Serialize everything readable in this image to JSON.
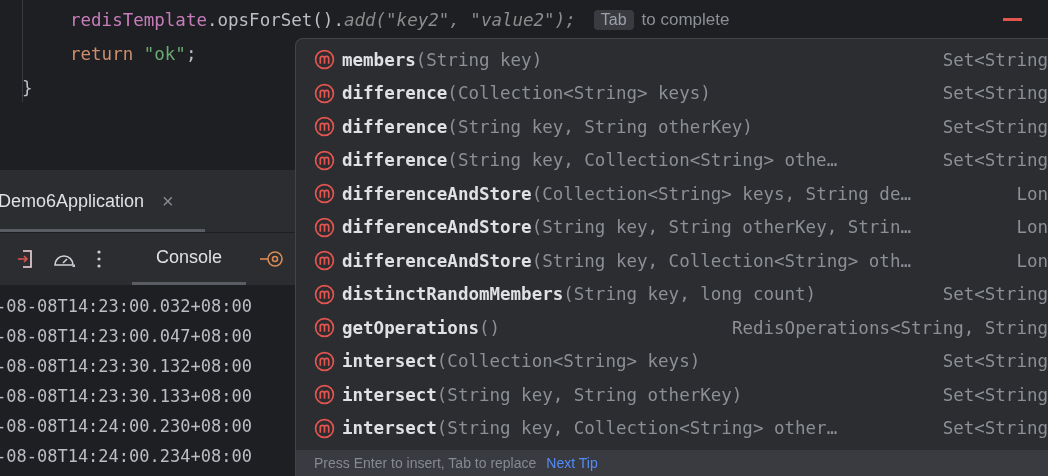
{
  "editor": {
    "lines": [
      {
        "indented": true,
        "tokens": [
          {
            "kind": "field",
            "text": "redisTemplate"
          },
          {
            "kind": "plain",
            "text": ".opsForSet()."
          },
          {
            "kind": "ghost",
            "text": "add(\"key2\", \"value2\");"
          }
        ],
        "hint": {
          "key": "Tab",
          "text": "to complete"
        }
      },
      {
        "indented": true,
        "tokens": [
          {
            "kind": "keyword",
            "text": "return "
          },
          {
            "kind": "string",
            "text": "\"ok\""
          },
          {
            "kind": "plain",
            "text": ";"
          }
        ]
      },
      {
        "indented": false,
        "tokens": [
          {
            "kind": "plain",
            "text": "}"
          }
        ]
      }
    ]
  },
  "run_panel": {
    "tab": {
      "title": "Demo6Application",
      "close": "×"
    },
    "console_tab": {
      "label": "Console",
      "selected": true
    },
    "log_lines": [
      "-08-08T14:23:00.032+08:00",
      "-08-08T14:23:00.047+08:00",
      "-08-08T14:23:30.132+08:00",
      "-08-08T14:23:30.133+08:00",
      "-08-08T14:24:00.230+08:00",
      "-08-08T14:24:00.234+08:00"
    ]
  },
  "completion": {
    "items": [
      {
        "name": "members",
        "params": "(String key)",
        "type": "Set<String"
      },
      {
        "name": "difference",
        "params": "(Collection<String> keys)",
        "type": "Set<String"
      },
      {
        "name": "difference",
        "params": "(String key, String otherKey)",
        "type": "Set<String"
      },
      {
        "name": "difference",
        "params": "(String key, Collection<String> othe…",
        "type": "Set<String"
      },
      {
        "name": "differenceAndStore",
        "params": "(Collection<String> keys, String de…",
        "type": "Lon"
      },
      {
        "name": "differenceAndStore",
        "params": "(String key, String otherKey, Strin…",
        "type": "Lon"
      },
      {
        "name": "differenceAndStore",
        "params": "(String key, Collection<String> oth…",
        "type": "Lon"
      },
      {
        "name": "distinctRandomMembers",
        "params": "(String key, long count)",
        "type": "Set<String"
      },
      {
        "name": "getOperations",
        "params": "()",
        "type": "RedisOperations<String, String"
      },
      {
        "name": "intersect",
        "params": "(Collection<String> keys)",
        "type": "Set<String"
      },
      {
        "name": "intersect",
        "params": "(String key, String otherKey)",
        "type": "Set<String"
      },
      {
        "name": "intersect",
        "params": "(String key, Collection<String> other…",
        "type": "Set<String"
      }
    ],
    "footer": {
      "text": "Press Enter to insert, Tab to replace",
      "link": "Next Tip"
    }
  }
}
